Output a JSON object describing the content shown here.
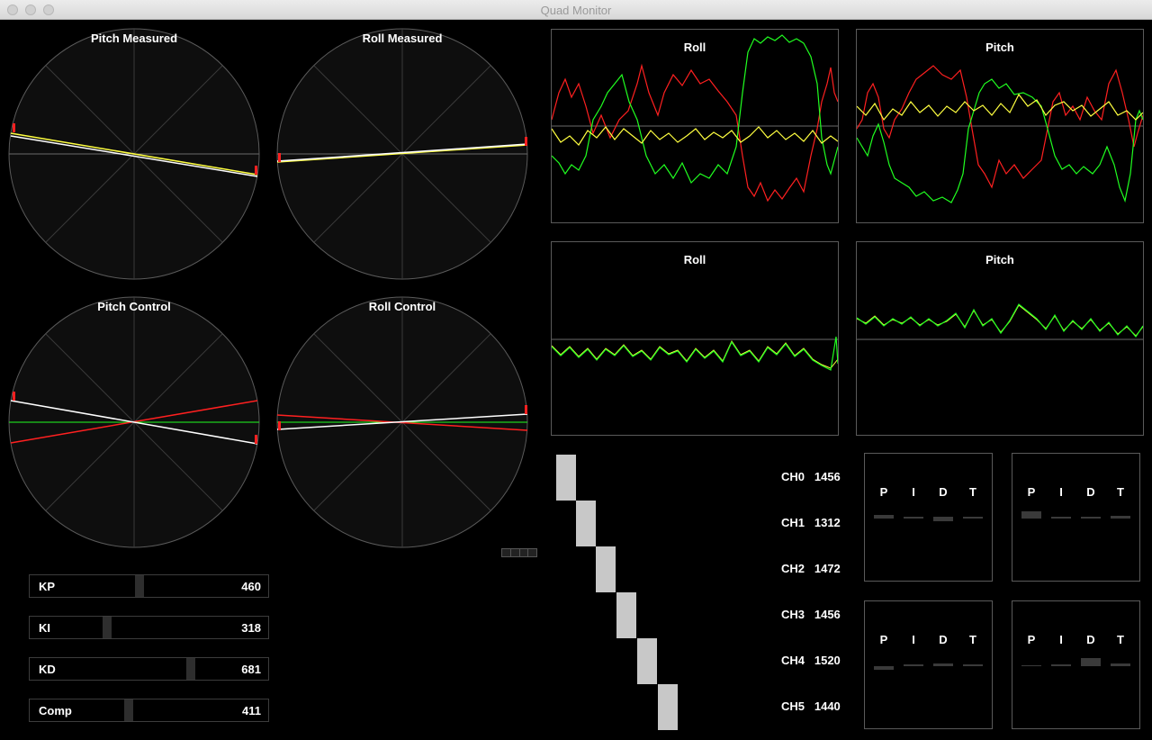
{
  "window": {
    "title": "Quad Monitor"
  },
  "dials": [
    {
      "label": "Pitch Measured"
    },
    {
      "label": "Roll Measured"
    },
    {
      "label": "Pitch Control"
    },
    {
      "label": "Roll Control"
    }
  ],
  "graphs": [
    {
      "title": "Roll"
    },
    {
      "title": "Pitch"
    },
    {
      "title": "Roll"
    },
    {
      "title": "Pitch"
    }
  ],
  "sliders": [
    {
      "label": "KP",
      "value": "460",
      "level": 0.46
    },
    {
      "label": "KI",
      "value": "318",
      "level": 0.318
    },
    {
      "label": "KD",
      "value": "681",
      "level": 0.681
    },
    {
      "label": "Comp",
      "value": "411",
      "level": 0.411
    }
  ],
  "channels": [
    {
      "name": "CH0",
      "value": "1456"
    },
    {
      "name": "CH1",
      "value": "1312"
    },
    {
      "name": "CH2",
      "value": "1472"
    },
    {
      "name": "CH3",
      "value": "1456"
    },
    {
      "name": "CH4",
      "value": "1520"
    },
    {
      "name": "CH5",
      "value": "1440"
    }
  ],
  "pid_panels": [
    {
      "letters": [
        "P",
        "I",
        "D",
        "T"
      ]
    },
    {
      "letters": [
        "P",
        "I",
        "D",
        "T"
      ]
    },
    {
      "letters": [
        "P",
        "I",
        "D",
        "T"
      ]
    },
    {
      "letters": [
        "P",
        "I",
        "D",
        "T"
      ]
    }
  ],
  "colors": {
    "background": "#000000",
    "dial_face": "#0e0e0e",
    "measured": "#ffffff",
    "setpoint": "#ffff40",
    "error": "#ff2020",
    "control": "#20ff20",
    "channel_bar": "#c8c8c8"
  }
}
